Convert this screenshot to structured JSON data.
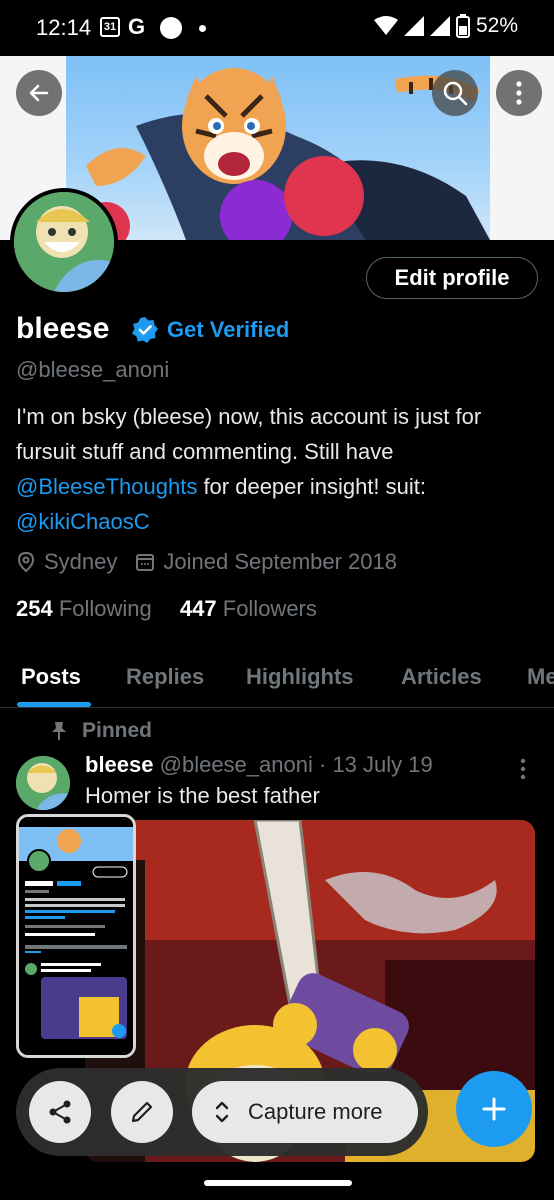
{
  "status_bar": {
    "time": "12:14",
    "calendar_day": "31",
    "g_label": "G",
    "battery": "52%"
  },
  "profile": {
    "display_name": "bleese",
    "get_verified": "Get Verified",
    "handle": "@bleese_anoni",
    "bio_1": "I'm on bsky (bleese) now, this account is just for fursuit stuff and commenting. Still have ",
    "bio_mention_1": "@BleeseThoughts",
    "bio_2": " for deeper insight!  suit: ",
    "bio_mention_2": "@kikiChaosC",
    "location": "Sydney",
    "joined": "Joined September 2018",
    "following_count": "254",
    "following_label": "Following",
    "followers_count": "447",
    "followers_label": "Followers",
    "edit_profile_label": "Edit profile"
  },
  "tabs": [
    "Posts",
    "Replies",
    "Highlights",
    "Articles",
    "Me"
  ],
  "post": {
    "pinned_label": "Pinned",
    "name": "bleese",
    "handle": "@bleese_anoni",
    "separator": "·",
    "date": "13 July 19",
    "text": "Homer is the best father"
  },
  "capture": {
    "capture_more_label": "Capture more"
  },
  "colors": {
    "accent": "#1d9bf0",
    "muted": "#71767b",
    "background": "#000000"
  }
}
